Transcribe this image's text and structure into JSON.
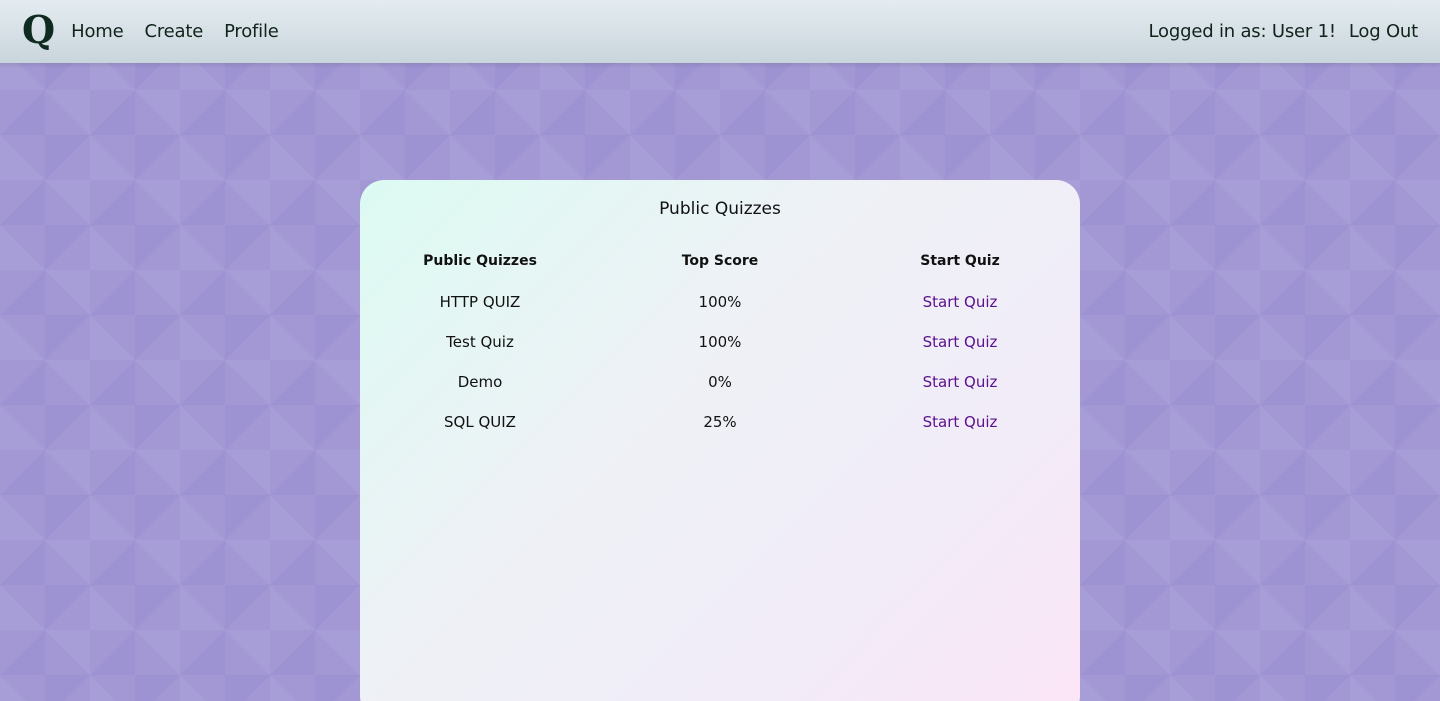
{
  "nav": {
    "logo": "Q",
    "links": [
      "Home",
      "Create",
      "Profile"
    ],
    "user_label": "Logged in as: User 1!",
    "logout_label": "Log Out"
  },
  "card": {
    "title": "Public Quizzes",
    "columns": [
      "Public Quizzes",
      "Top Score",
      "Start Quiz"
    ],
    "rows": [
      {
        "name": "HTTP QUIZ",
        "score": "100%",
        "action": "Start Quiz"
      },
      {
        "name": "Test Quiz",
        "score": "100%",
        "action": "Start Quiz"
      },
      {
        "name": "Demo",
        "score": "0%",
        "action": "Start Quiz"
      },
      {
        "name": "SQL QUIZ",
        "score": "25%",
        "action": "Start Quiz"
      }
    ]
  },
  "colors": {
    "background": "#a398d4",
    "navbar": "#d6e0e5",
    "link": "#5a0f8c"
  }
}
